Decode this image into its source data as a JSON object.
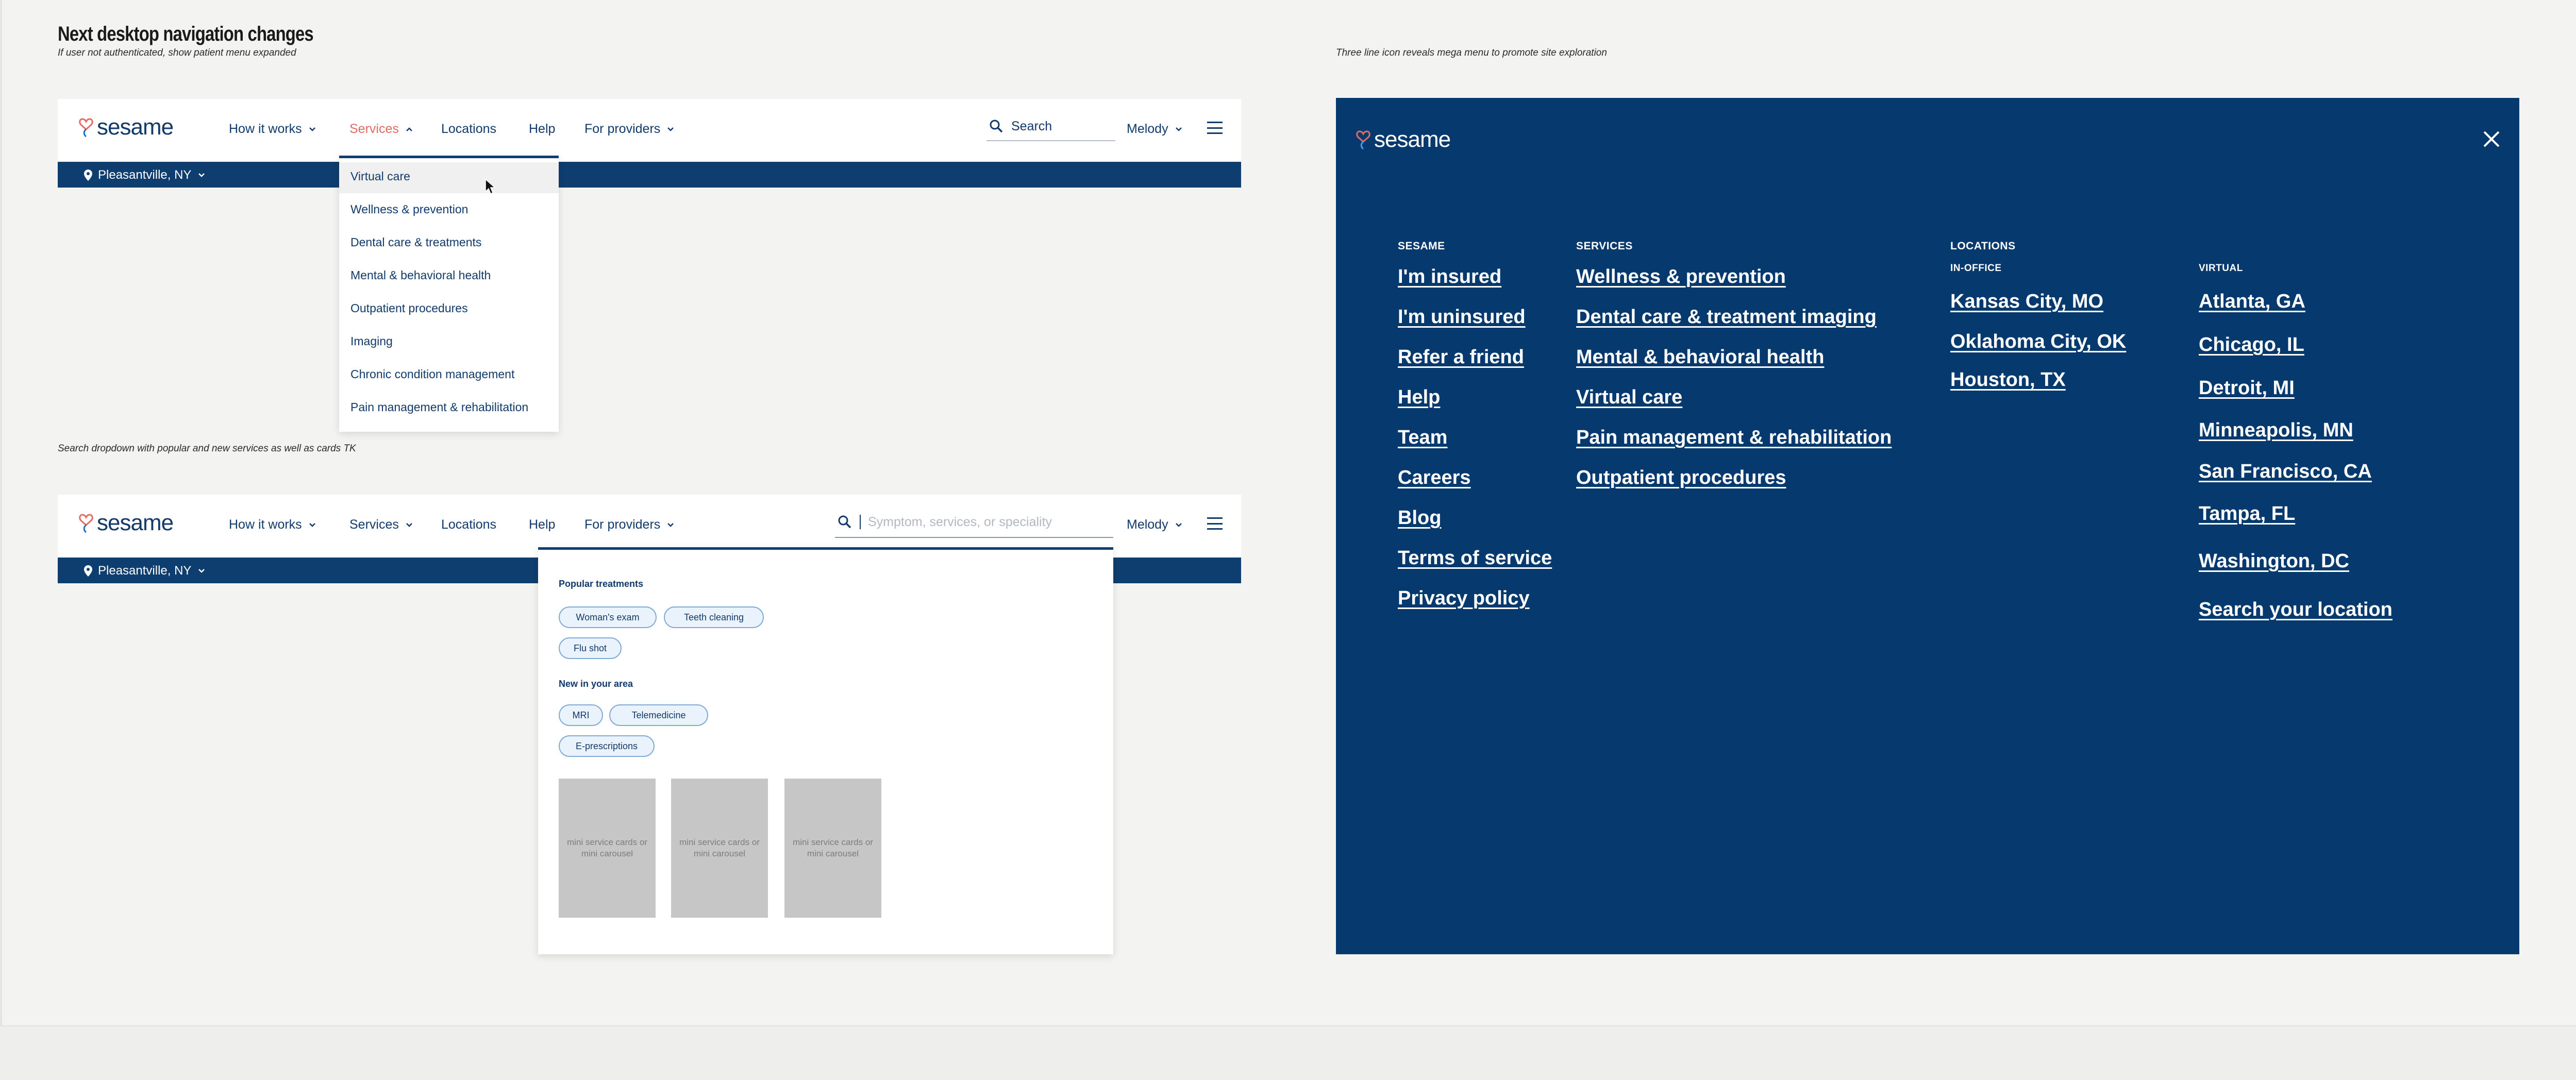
{
  "page": {
    "title": "Next desktop navigation changes",
    "subtitle": "If user not authenticated, show patient menu expanded",
    "search_caption": "Search dropdown with popular and new services as well as cards TK",
    "mega_caption": "Three line icon reveals mega menu to promote site exploration"
  },
  "brand": {
    "name": "sesame",
    "navy": "#0e3e6f",
    "accent": "#e46b63",
    "logo_icon": "heart-logo-icon"
  },
  "nav1": {
    "how_it_works": "How it works",
    "services": "Services",
    "locations": "Locations",
    "help": "Help",
    "for_providers": "For providers",
    "search_label": "Search",
    "user": "Melody",
    "location": "Pleasantville, NY",
    "menu_icon": "hamburger-menu-icon"
  },
  "services_dropdown": {
    "items": [
      "Virtual care",
      "Wellness & prevention",
      "Dental care & treatments",
      "Mental & behavioral health",
      "Outpatient procedures",
      "Imaging",
      "Chronic condition management",
      "Pain management & rehabilitation"
    ],
    "hovered": "Virtual care"
  },
  "nav2": {
    "how_it_works": "How it works",
    "services": "Services",
    "locations": "Locations",
    "help": "Help",
    "for_providers": "For providers",
    "search_placeholder": "Symptom, services, or speciality",
    "user": "Melody",
    "location": "Pleasantville, NY"
  },
  "search_dropdown": {
    "popular_heading": "Popular treatments",
    "popular": [
      "Woman's exam",
      "Teeth cleaning",
      "Flu shot"
    ],
    "new_heading": "New in your area",
    "new_items": [
      "MRI",
      "Telemedicine",
      "E-prescriptions"
    ],
    "card_text": "mini service cards or mini carousel"
  },
  "mega_menu": {
    "close_icon": "close-icon",
    "sesame": {
      "heading": "SESAME",
      "links": [
        "I'm insured",
        "I'm uninsured",
        "Refer a friend",
        "Help",
        "Team",
        "Careers",
        "Blog",
        "Terms of service",
        "Privacy policy"
      ]
    },
    "services": {
      "heading": "SERVICES",
      "links": [
        "Wellness & prevention",
        "Dental care & treatment imaging",
        "Mental & behavioral health",
        "Virtual care",
        "Pain management & rehabilitation",
        "Outpatient procedures"
      ]
    },
    "locations": {
      "heading": "LOCATIONS",
      "in_office_heading": "IN-OFFICE",
      "in_office": [
        "Kansas City, MO",
        "Oklahoma City, OK",
        "Houston, TX"
      ],
      "virtual_heading": "VIRTUAL",
      "virtual": [
        "Atlanta, GA",
        "Chicago, IL",
        "Detroit, MI",
        "Minneapolis, MN",
        "San Francisco, CA",
        "Tampa, FL",
        "Washington, DC",
        "Search your location"
      ]
    }
  }
}
